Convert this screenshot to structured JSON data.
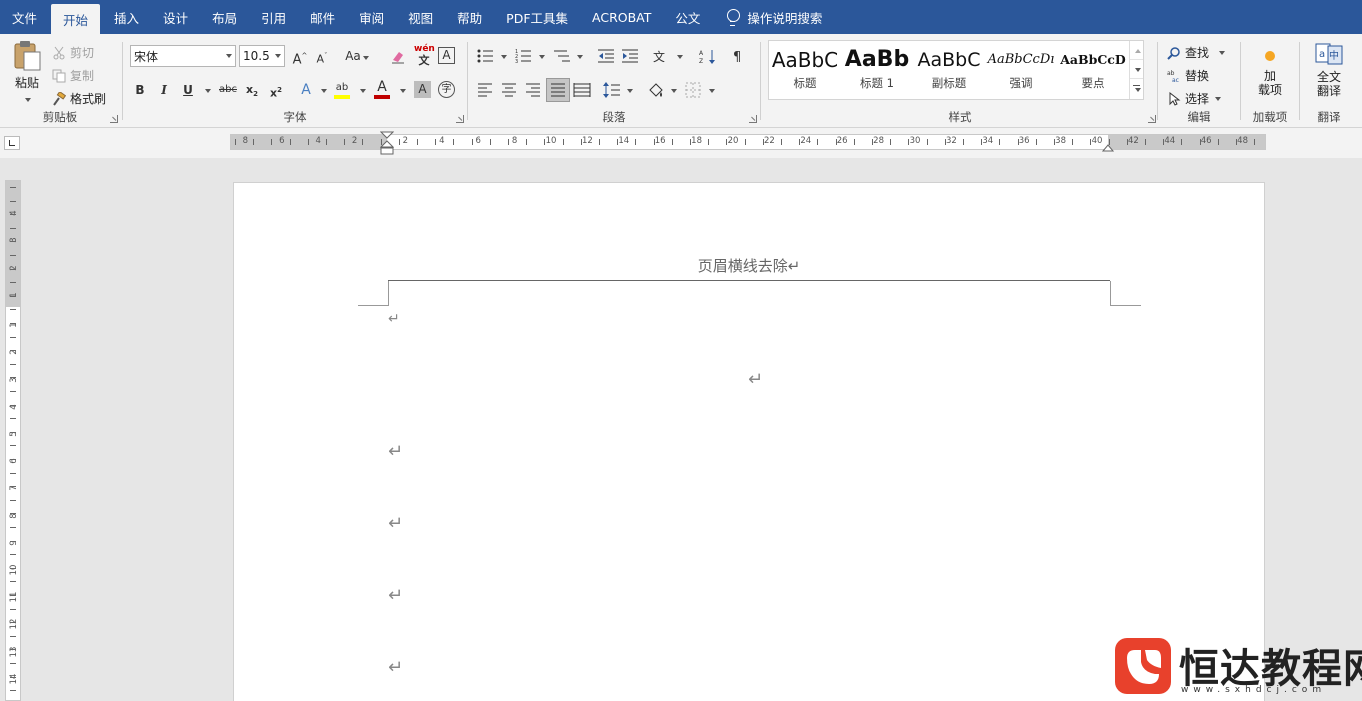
{
  "tabs": [
    {
      "label": "文件",
      "active": false
    },
    {
      "label": "开始",
      "active": true
    },
    {
      "label": "插入",
      "active": false
    },
    {
      "label": "设计",
      "active": false
    },
    {
      "label": "布局",
      "active": false
    },
    {
      "label": "引用",
      "active": false
    },
    {
      "label": "邮件",
      "active": false
    },
    {
      "label": "审阅",
      "active": false
    },
    {
      "label": "视图",
      "active": false
    },
    {
      "label": "帮助",
      "active": false
    },
    {
      "label": "PDF工具集",
      "active": false
    },
    {
      "label": "ACROBAT",
      "active": false
    },
    {
      "label": "公文",
      "active": false
    }
  ],
  "tell_me": "操作说明搜索",
  "clipboard": {
    "paste": "粘贴",
    "cut": "剪切",
    "copy": "复制",
    "format_painter": "格式刷",
    "label": "剪贴板"
  },
  "font": {
    "name": "宋体",
    "size": "10.5",
    "case_label": "Aa",
    "label": "字体"
  },
  "paragraph": {
    "label": "段落"
  },
  "styles": {
    "label": "样式",
    "items": [
      {
        "sample": "AaBbC",
        "name": "标题"
      },
      {
        "sample": "AaBb",
        "name": "标题 1"
      },
      {
        "sample": "AaBbC",
        "name": "副标题"
      },
      {
        "sample": "AaBbCcDı",
        "name": "强调"
      },
      {
        "sample": "AaBbCcD",
        "name": "要点"
      }
    ]
  },
  "editing": {
    "find": "查找",
    "replace": "替换",
    "select": "选择",
    "label": "编辑"
  },
  "addins": {
    "button": "加\n载项",
    "label": "加载项"
  },
  "translate": {
    "button": "全文\n翻译",
    "label": "翻译"
  },
  "ruler": {
    "h_left_numbers": [
      "8",
      "6",
      "4",
      "2"
    ],
    "h_right_numbers": [
      "2",
      "4",
      "6",
      "8",
      "10",
      "12",
      "14",
      "16",
      "18",
      "20",
      "22",
      "24",
      "26",
      "28",
      "30",
      "32",
      "34",
      "36",
      "38",
      "40",
      "42",
      "44",
      "46",
      "48"
    ],
    "v_top_numbers": [
      "4",
      "3",
      "2",
      "1"
    ],
    "v_numbers": [
      "1",
      "2",
      "3",
      "4",
      "5",
      "6",
      "7",
      "8",
      "9",
      "10",
      "11",
      "12",
      "13",
      "14"
    ]
  },
  "document": {
    "header_text": "页眉横线去除↵",
    "paragraph_mark": "↵"
  },
  "watermark": {
    "title": "恒达教程网",
    "url": "www.sxhdcj.com",
    "color": "#e8412c"
  },
  "colors": {
    "tabbar": "#2b579a",
    "ribbon": "#f3f3f3",
    "font_color": "#c00000",
    "highlight": "#ffff00",
    "addin_dot": "#f5a623"
  }
}
